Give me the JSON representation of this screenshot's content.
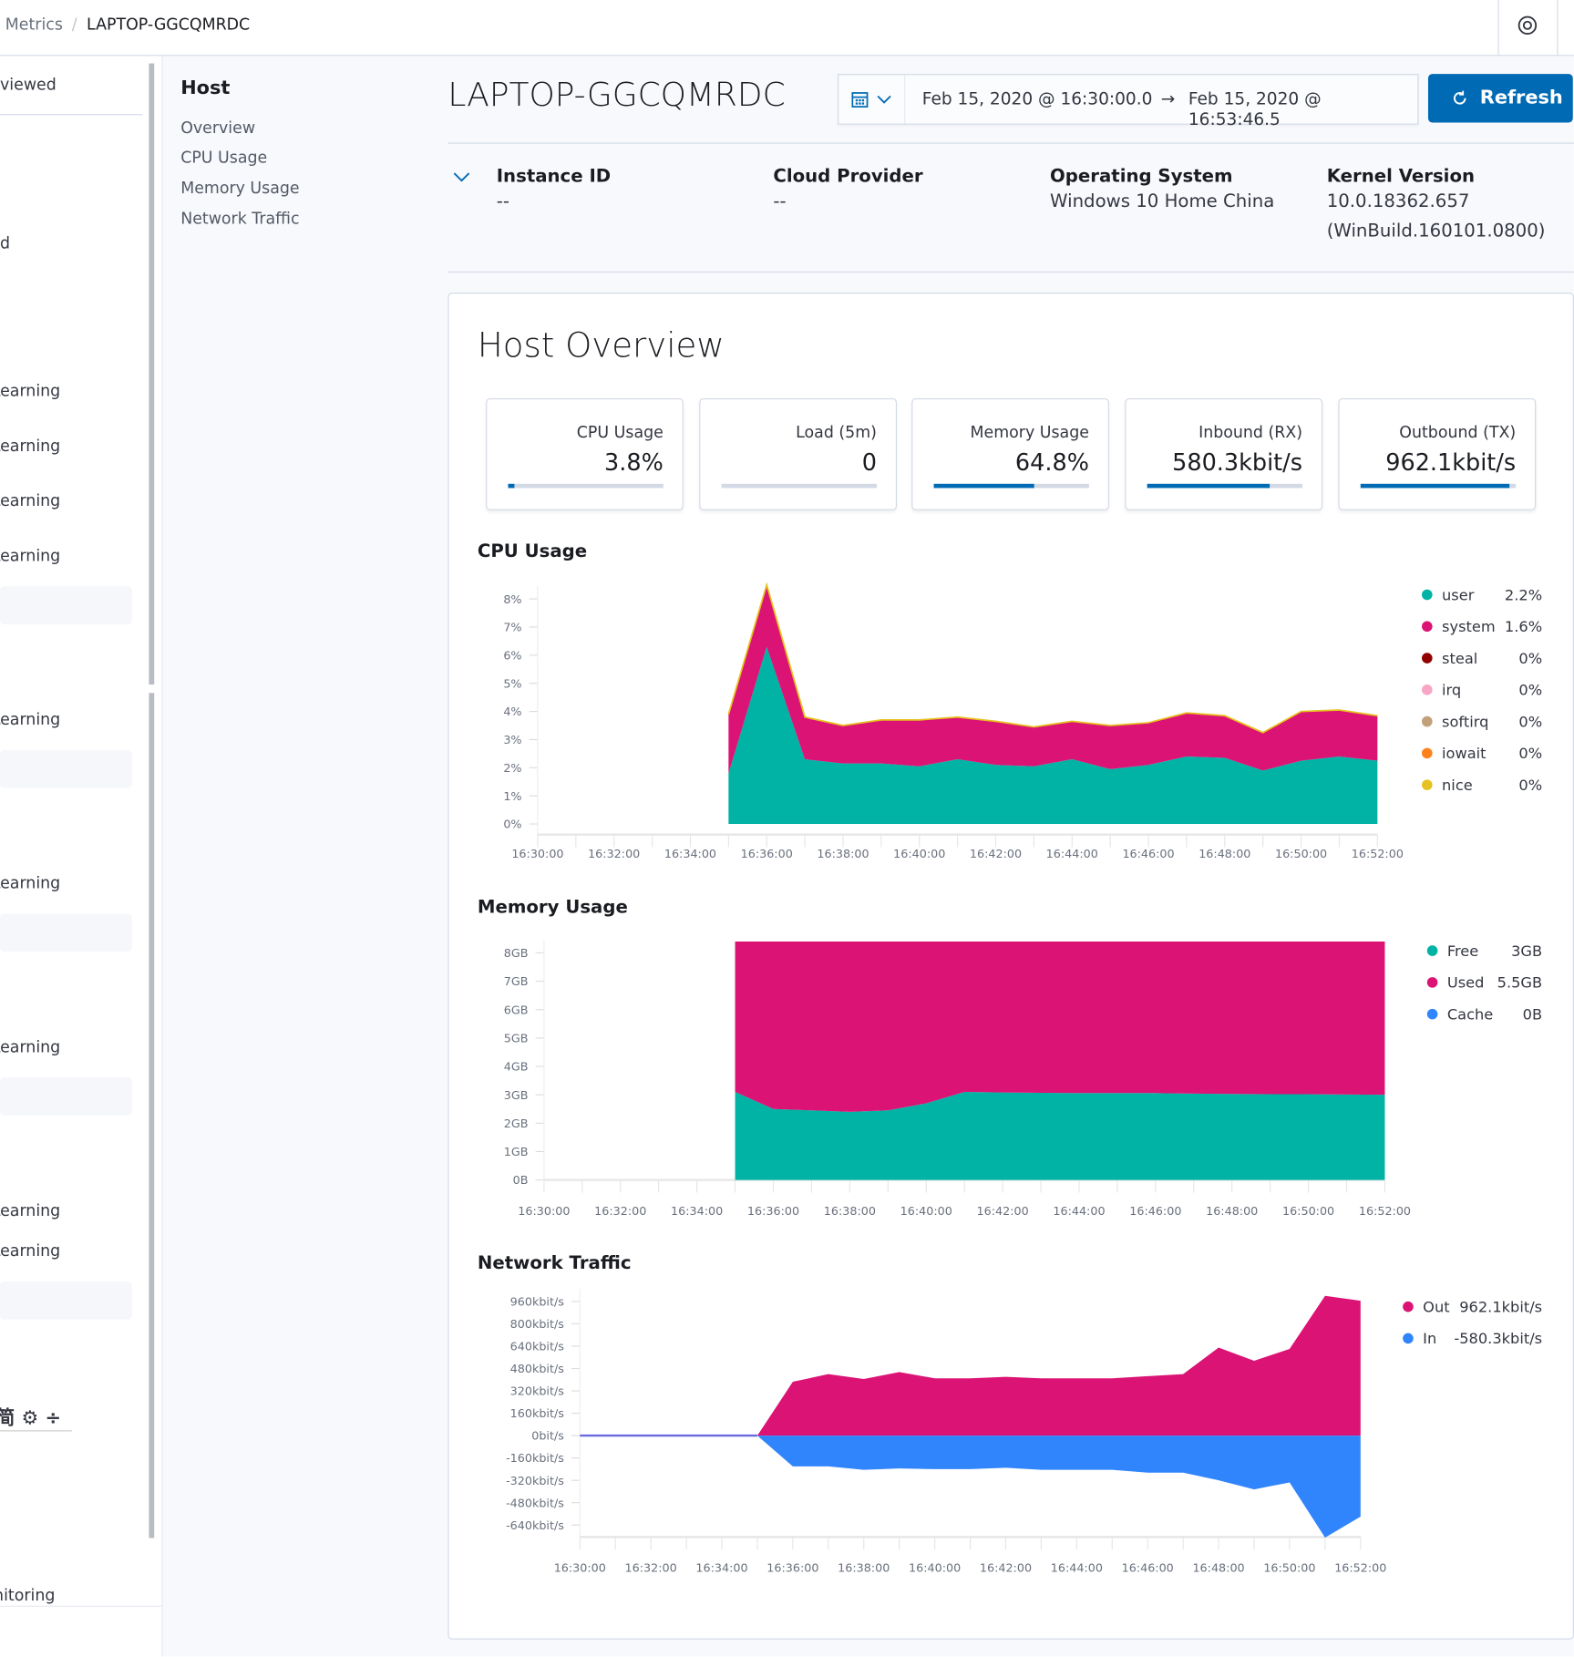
{
  "breadcrumb": {
    "parent": "Metrics",
    "current": "LAPTOP-GGCQMRDC"
  },
  "left_nav": {
    "items": [
      "viewed",
      "d",
      "Learning",
      "Learning",
      "Learning",
      "Learning",
      "Learning",
      "Learning",
      "Learning",
      "Learning",
      "Learning",
      "nitoring"
    ],
    "lang_selector": "简 ⚙ ÷"
  },
  "section_nav": {
    "title": "Host",
    "items": [
      "Overview",
      "CPU Usage",
      "Memory Usage",
      "Network Traffic"
    ]
  },
  "header": {
    "title": "LAPTOP-GGCQMRDC",
    "date_start": "Feb 15, 2020 @ 16:30:00.0",
    "date_arrow": "→",
    "date_end": "Feb 15, 2020 @ 16:53:46.5",
    "refresh_label": "Refresh",
    "refresh_color": "#006bb4"
  },
  "metadata": [
    {
      "label": "Instance ID",
      "value": "--"
    },
    {
      "label": "Cloud Provider",
      "value": "--"
    },
    {
      "label": "Operating System",
      "value": "Windows 10 Home China"
    },
    {
      "label": "Kernel Version",
      "value": "10.0.18362.657 (WinBuild.160101.0800)"
    }
  ],
  "overview": {
    "title": "Host Overview",
    "cards": [
      {
        "label": "CPU Usage",
        "value": "3.8%",
        "fraction": 0.038
      },
      {
        "label": "Load (5m)",
        "value": "0",
        "fraction": 0
      },
      {
        "label": "Memory Usage",
        "value": "64.8%",
        "fraction": 0.648
      },
      {
        "label": "Inbound (RX)",
        "value": "580.3kbit/s",
        "fraction": 0.79
      },
      {
        "label": "Outbound (TX)",
        "value": "962.1kbit/s",
        "fraction": 0.96
      }
    ]
  },
  "chart_data": [
    {
      "type": "area",
      "stacked": true,
      "title": "CPU Usage",
      "x_ticks": [
        "16:30:00",
        "16:32:00",
        "16:34:00",
        "16:36:00",
        "16:38:00",
        "16:40:00",
        "16:42:00",
        "16:44:00",
        "16:46:00",
        "16:48:00",
        "16:50:00",
        "16:52:00"
      ],
      "y_ticks": [
        "0%",
        "1%",
        "2%",
        "3%",
        "4%",
        "5%",
        "6%",
        "7%",
        "8%"
      ],
      "ylim": [
        0,
        8
      ],
      "xlim": [
        "16:30",
        "16:52"
      ],
      "x": [
        "16:35",
        "16:36",
        "16:37",
        "16:38",
        "16:39",
        "16:40",
        "16:41",
        "16:42",
        "16:43",
        "16:44",
        "16:45",
        "16:46",
        "16:47",
        "16:48",
        "16:49",
        "16:50",
        "16:51",
        "16:52"
      ],
      "series": [
        {
          "name": "user",
          "legend_value": "2.2%",
          "color": "#00b3a4",
          "values": [
            1.8,
            6.3,
            2.3,
            2.15,
            2.15,
            2.05,
            2.3,
            2.1,
            2.05,
            2.3,
            1.95,
            2.1,
            2.4,
            2.35,
            1.9,
            2.25,
            2.4,
            2.25
          ]
        },
        {
          "name": "system",
          "legend_value": "1.6%",
          "color": "#db1374",
          "values": [
            2.1,
            2.2,
            1.5,
            1.35,
            1.55,
            1.65,
            1.5,
            1.55,
            1.4,
            1.35,
            1.55,
            1.5,
            1.55,
            1.5,
            1.35,
            1.75,
            1.65,
            1.6
          ]
        },
        {
          "name": "steal",
          "legend_value": "0%",
          "color": "#920000",
          "values": []
        },
        {
          "name": "irq",
          "legend_value": "0%",
          "color": "#f8a5c6",
          "values": []
        },
        {
          "name": "softirq",
          "legend_value": "0%",
          "color": "#c2a079",
          "values": []
        },
        {
          "name": "iowait",
          "legend_value": "0%",
          "color": "#fd821b",
          "values": []
        },
        {
          "name": "nice",
          "legend_value": "0%",
          "color": "#e6c220",
          "values": []
        }
      ]
    },
    {
      "type": "area",
      "stacked": true,
      "title": "Memory Usage",
      "x_ticks": [
        "16:30:00",
        "16:32:00",
        "16:34:00",
        "16:36:00",
        "16:38:00",
        "16:40:00",
        "16:42:00",
        "16:44:00",
        "16:46:00",
        "16:48:00",
        "16:50:00",
        "16:52:00"
      ],
      "y_ticks": [
        "0B",
        "1GB",
        "2GB",
        "3GB",
        "4GB",
        "5GB",
        "6GB",
        "7GB",
        "8GB"
      ],
      "ylim": [
        0,
        8
      ],
      "xlim": [
        "16:30",
        "16:52"
      ],
      "x": [
        "16:35",
        "16:36",
        "16:37",
        "16:38",
        "16:39",
        "16:40",
        "16:41",
        "16:42",
        "16:43",
        "16:44",
        "16:45",
        "16:46",
        "16:47",
        "16:48",
        "16:49",
        "16:50",
        "16:51",
        "16:52"
      ],
      "series": [
        {
          "name": "Free",
          "legend_value": "3GB",
          "color": "#00b3a4",
          "values": [
            3.1,
            2.5,
            2.45,
            2.4,
            2.45,
            2.7,
            3.1,
            3.08,
            3.07,
            3.06,
            3.06,
            3.06,
            3.04,
            3.03,
            3.02,
            3.02,
            3.01,
            3.0
          ]
        },
        {
          "name": "Used",
          "legend_value": "5.5GB",
          "color": "#db1374",
          "values": [
            5.3,
            5.9,
            5.95,
            6.0,
            5.95,
            5.7,
            5.3,
            5.32,
            5.33,
            5.34,
            5.34,
            5.34,
            5.36,
            5.37,
            5.38,
            5.38,
            5.39,
            5.4
          ]
        },
        {
          "name": "Cache",
          "legend_value": "0B",
          "color": "#3185fc",
          "values": []
        }
      ]
    },
    {
      "type": "area",
      "stacked": false,
      "title": "Network Traffic",
      "x_ticks": [
        "16:30:00",
        "16:32:00",
        "16:34:00",
        "16:36:00",
        "16:38:00",
        "16:40:00",
        "16:42:00",
        "16:44:00",
        "16:46:00",
        "16:48:00",
        "16:50:00",
        "16:52:00"
      ],
      "y_ticks": [
        "-640kbit/s",
        "-480kbit/s",
        "-320kbit/s",
        "-160kbit/s",
        "0bit/s",
        "160kbit/s",
        "320kbit/s",
        "480kbit/s",
        "640kbit/s",
        "800kbit/s",
        "960kbit/s"
      ],
      "ylim": [
        -735,
        1000
      ],
      "xlim": [
        "16:30",
        "16:52"
      ],
      "x": [
        "16:35",
        "16:36",
        "16:37",
        "16:38",
        "16:39",
        "16:40",
        "16:41",
        "16:42",
        "16:43",
        "16:44",
        "16:45",
        "16:46",
        "16:47",
        "16:48",
        "16:49",
        "16:50",
        "16:51",
        "16:52"
      ],
      "series": [
        {
          "name": "Out",
          "legend_value": "962.1kbit/s",
          "color": "#db1374",
          "values": [
            0,
            385,
            440,
            405,
            455,
            410,
            410,
            420,
            410,
            410,
            410,
            425,
            440,
            630,
            535,
            620,
            1000,
            965
          ]
        },
        {
          "name": "In",
          "legend_value": "-580.3kbit/s",
          "color": "#3185fc",
          "values": [
            0,
            -220,
            -220,
            -245,
            -235,
            -240,
            -240,
            -230,
            -245,
            -245,
            -245,
            -265,
            -265,
            -320,
            -385,
            -335,
            -730,
            -580
          ]
        }
      ]
    }
  ]
}
